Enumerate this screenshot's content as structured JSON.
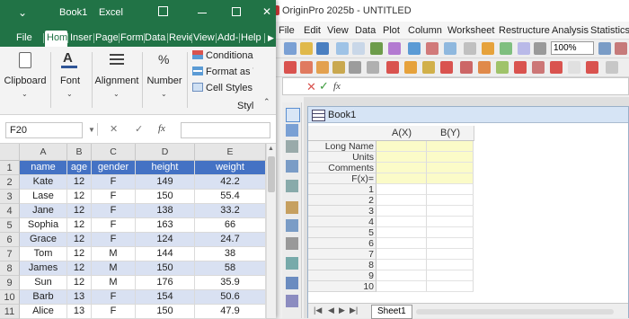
{
  "origin": {
    "title": "OriginPro 2025b - UNTITLED",
    "menu": [
      "File",
      "Edit",
      "View",
      "Data",
      "Plot",
      "Column",
      "Worksheet",
      "Restructure",
      "Analysis",
      "Statistics"
    ],
    "zoom": "100%",
    "book": {
      "title": "Book1",
      "columns": [
        "A(X)",
        "B(Y)"
      ],
      "meta_rows": [
        "Long Name",
        "Units",
        "Comments",
        "F(x)="
      ],
      "rows": [
        "1",
        "2",
        "3",
        "4",
        "5",
        "6",
        "7",
        "8",
        "9",
        "10"
      ],
      "sheet_tab": "Sheet1"
    }
  },
  "excel": {
    "title": {
      "book": "Book1",
      "app": "Excel"
    },
    "tabs": [
      "File",
      "Hom",
      "Inser",
      "Page",
      "Form",
      "Data",
      "Revie",
      "View",
      "Add-",
      "Help"
    ],
    "ribbon": {
      "clipboard": "Clipboard",
      "font": "Font",
      "alignment": "Alignment",
      "number": "Number",
      "conditional": "Conditional",
      "format_as_table": "Format as Ta",
      "cell_styles": "Cell Styles",
      "styles_group": "Styl"
    },
    "name_box": "F20",
    "fx_label": "fx",
    "columns": [
      "A",
      "B",
      "C",
      "D",
      "E"
    ],
    "header_row": [
      "name",
      "age",
      "gender",
      "height",
      "weight"
    ],
    "rows": [
      [
        "Kate",
        "12",
        "F",
        "149",
        "42.2"
      ],
      [
        "Lase",
        "12",
        "F",
        "150",
        "55.4"
      ],
      [
        "Jane",
        "12",
        "F",
        "138",
        "33.2"
      ],
      [
        "Sophia",
        "12",
        "F",
        "163",
        "66"
      ],
      [
        "Grace",
        "12",
        "F",
        "124",
        "24.7"
      ],
      [
        "Tom",
        "12",
        "M",
        "144",
        "38"
      ],
      [
        "James",
        "12",
        "M",
        "150",
        "58"
      ],
      [
        "Sun",
        "12",
        "M",
        "176",
        "35.9"
      ],
      [
        "Barb",
        "13",
        "F",
        "154",
        "50.6"
      ],
      [
        "Alice",
        "13",
        "F",
        "150",
        "47.9"
      ]
    ],
    "row_numbers": [
      "1",
      "2",
      "3",
      "4",
      "5",
      "6",
      "7",
      "8",
      "9",
      "10",
      "11"
    ]
  },
  "colors": {
    "excel_green": "#217346",
    "table_header": "#4472c4",
    "table_band": "#d9e1f2",
    "origin_meta": "#fbfbc8"
  }
}
